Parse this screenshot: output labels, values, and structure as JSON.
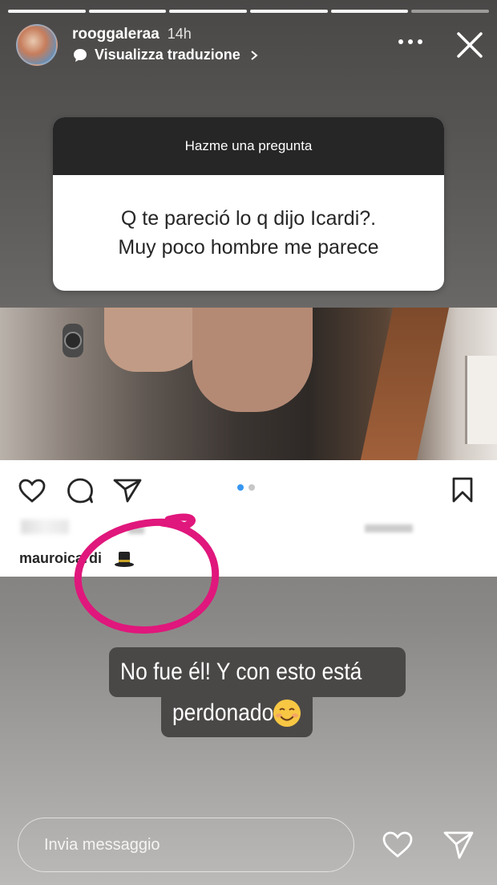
{
  "story": {
    "progress_segments": 6,
    "progress_done": 5
  },
  "header": {
    "username": "rooggaleraa",
    "time": "14h",
    "translate_label": "Visualizza traduzione",
    "more_icon": "more-dots-icon",
    "close_icon": "close-icon"
  },
  "question_sticker": {
    "heading": "Hazme una pregunta",
    "question_line1": "Q te pareció lo q dijo Icardi?.",
    "question_line2": "Muy poco hombre me parece"
  },
  "shared_post": {
    "carousel_pages": 2,
    "carousel_active": 1,
    "caption_user": "mauroicardi",
    "caption_emoji": "top-hat-emoji",
    "icons": [
      "heart-icon",
      "comment-icon",
      "share-icon",
      "bookmark-icon"
    ]
  },
  "annotation": {
    "circle_color": "#e0177c"
  },
  "text_sticker": {
    "line1": "No fue él! Y con esto está",
    "line2": "perdonado",
    "emoji": "smiling-face-emoji"
  },
  "reply": {
    "placeholder": "Invia messaggio"
  },
  "colors": {
    "sticker_bg": "#4a4847",
    "card_head_bg": "#262626",
    "carousel_active": "#3897f0"
  }
}
